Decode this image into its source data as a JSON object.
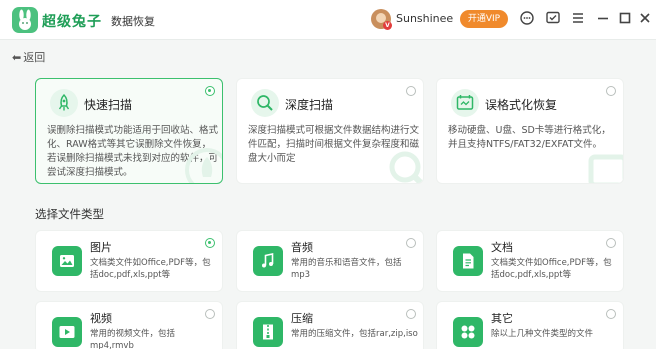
{
  "app": {
    "brand": "超级兔子",
    "subtitle": "数据恢复"
  },
  "header": {
    "username": "Sunshinee",
    "avatar_badge": "V",
    "vip_label": "开通VIP",
    "icons": [
      "support-icon",
      "feedback-icon",
      "menu-icon",
      "minimize-icon",
      "maximize-icon",
      "close-icon"
    ]
  },
  "nav": {
    "back_label": "返回",
    "back_arrow": "⬅"
  },
  "modes": [
    {
      "title": "快速扫描",
      "desc": "误删除扫描模式功能适用于回收站、格式化、RAW格式等其它误删除文件恢复，若误删除扫描模式未找到对应的软件，可尝试深度扫描模式。",
      "selected": true,
      "icon": "rocket-icon"
    },
    {
      "title": "深度扫描",
      "desc": "深度扫描模式可根据文件数据结构进行文件匹配，扫描时间根据文件复杂程度和磁盘大小而定",
      "selected": false,
      "icon": "magnifier-icon"
    },
    {
      "title": "误格式化恢复",
      "desc": "移动硬盘、U盘、SD卡等进行格式化，并且支持NTFS/FAT32/EXFAT文件。",
      "selected": false,
      "icon": "format-disk-icon"
    }
  ],
  "section": {
    "file_types_title": "选择文件类型"
  },
  "file_types": [
    {
      "title": "图片",
      "desc": "文档类文件如Office,PDF等，包括doc,pdf,xls,ppt等",
      "selected": true,
      "icon": "image-icon"
    },
    {
      "title": "音频",
      "desc": "常用的音乐和语音文件，包括mp3",
      "selected": false,
      "icon": "music-icon"
    },
    {
      "title": "文档",
      "desc": "文档类文件如Office,PDF等，包括doc,pdf,xls,ppt等",
      "selected": false,
      "icon": "document-icon"
    },
    {
      "title": "视频",
      "desc": "常用的视频文件，包括mp4,rmvb",
      "selected": false,
      "icon": "video-icon"
    },
    {
      "title": "压缩",
      "desc": "常用的压缩文件，包括rar,zip,iso",
      "selected": false,
      "icon": "archive-icon"
    },
    {
      "title": "其它",
      "desc": "除以上几种文件类型的文件",
      "selected": false,
      "icon": "grid-icon"
    }
  ],
  "colors": {
    "accent": "#3cc06e",
    "vip": "#f08a2c",
    "background": "#f4f6f5"
  }
}
